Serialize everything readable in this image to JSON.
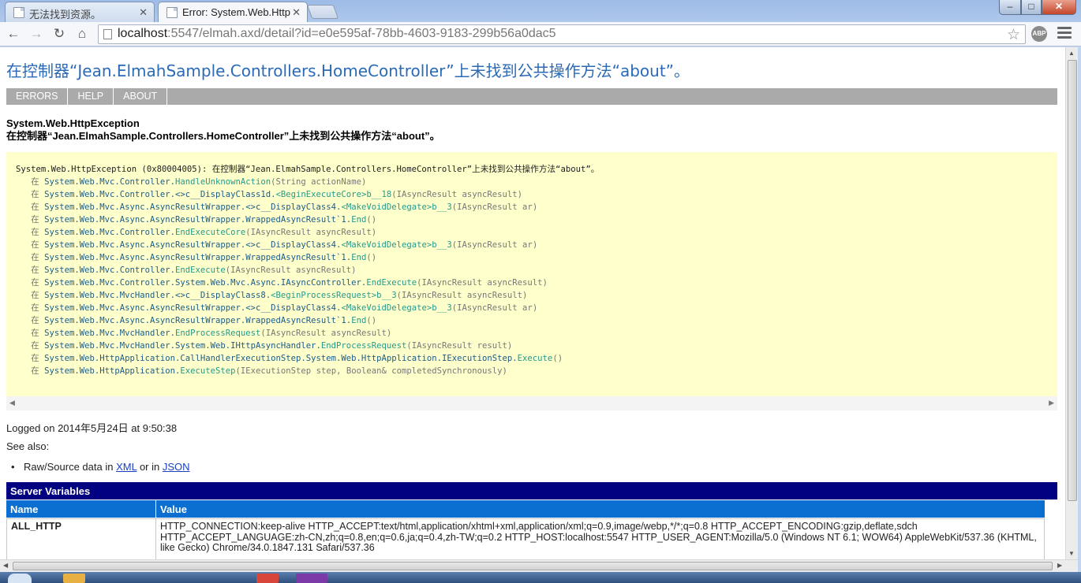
{
  "tabs": [
    {
      "title": "无法找到资源。",
      "active": false
    },
    {
      "title": "Error: System.Web.Http",
      "active": true
    }
  ],
  "window_buttons": {
    "minimize": "–",
    "maximize": "□",
    "close": "✕"
  },
  "toolbar": {
    "back": "←",
    "forward": "→",
    "reload": "↻",
    "home": "⌂",
    "url_host": "localhost",
    "url_path": ":5547/elmah.axd/detail?id=e0e595af-78bb-4603-9183-299b56a0dac5",
    "star": "☆",
    "abp": "ABP"
  },
  "page": {
    "title": "在控制器“Jean.ElmahSample.Controllers.HomeController”上未找到公共操作方法“about”。",
    "nav": [
      "ERRORS",
      "HELP",
      "ABOUT"
    ],
    "error_type": "System.Web.HttpException",
    "error_message": "在控制器“Jean.ElmahSample.Controllers.HomeController”上未找到公共操作方法“about”。",
    "trace_header": "System.Web.HttpException (0x80004005): 在控制器“Jean.ElmahSample.Controllers.HomeController”上未找到公共操作方法“about”。",
    "trace_lines": [
      {
        "pre": "System.Web.Mvc.Controller.",
        "hl": "HandleUnknownAction",
        "post": "(String actionName)"
      },
      {
        "pre": "System.Web.Mvc.Controller.<>c__DisplayClass1d.",
        "hl": "<BeginExecuteCore>b__18",
        "post": "(IAsyncResult asyncResult)"
      },
      {
        "pre": "System.Web.Mvc.Async.AsyncResultWrapper.<>c__DisplayClass4.",
        "hl": "<MakeVoidDelegate>b__3",
        "post": "(IAsyncResult ar)"
      },
      {
        "pre": "System.Web.Mvc.Async.AsyncResultWrapper.WrappedAsyncResult`1.",
        "hl": "End",
        "post": "()"
      },
      {
        "pre": "System.Web.Mvc.Controller.",
        "hl": "EndExecuteCore",
        "post": "(IAsyncResult asyncResult)"
      },
      {
        "pre": "System.Web.Mvc.Async.AsyncResultWrapper.<>c__DisplayClass4.",
        "hl": "<MakeVoidDelegate>b__3",
        "post": "(IAsyncResult ar)"
      },
      {
        "pre": "System.Web.Mvc.Async.AsyncResultWrapper.WrappedAsyncResult`1.",
        "hl": "End",
        "post": "()"
      },
      {
        "pre": "System.Web.Mvc.Controller.",
        "hl": "EndExecute",
        "post": "(IAsyncResult asyncResult)"
      },
      {
        "pre": "System.Web.Mvc.Controller.System.Web.Mvc.Async.IAsyncController.",
        "hl": "EndExecute",
        "post": "(IAsyncResult asyncResult)"
      },
      {
        "pre": "System.Web.Mvc.MvcHandler.<>c__DisplayClass8.",
        "hl": "<BeginProcessRequest>b__3",
        "post": "(IAsyncResult asyncResult)"
      },
      {
        "pre": "System.Web.Mvc.Async.AsyncResultWrapper.<>c__DisplayClass4.",
        "hl": "<MakeVoidDelegate>b__3",
        "post": "(IAsyncResult ar)"
      },
      {
        "pre": "System.Web.Mvc.Async.AsyncResultWrapper.WrappedAsyncResult`1.",
        "hl": "End",
        "post": "()"
      },
      {
        "pre": "System.Web.Mvc.MvcHandler.",
        "hl": "EndProcessRequest",
        "post": "(IAsyncResult asyncResult)"
      },
      {
        "pre": "System.Web.Mvc.MvcHandler.System.Web.IHttpAsyncHandler.",
        "hl": "EndProcessRequest",
        "post": "(IAsyncResult result)"
      },
      {
        "pre": "System.Web.HttpApplication.CallHandlerExecutionStep.System.Web.HttpApplication.IExecutionStep.",
        "hl": "Execute",
        "post": "()"
      },
      {
        "pre": "System.Web.HttpApplication.",
        "hl": "ExecuteStep",
        "post": "(IExecutionStep step, Boolean& completedSynchronously)"
      }
    ],
    "trace_prefix": "在",
    "logged_on": "Logged on 2014年5月24日 at 9:50:38",
    "see_also": "See also:",
    "raw_prefix": "Raw/Source data in",
    "raw_xml": "XML",
    "raw_or": "or in",
    "raw_json": "JSON",
    "server_variables": {
      "title": "Server Variables",
      "col_name": "Name",
      "col_value": "Value",
      "rows": [
        {
          "name": "ALL_HTTP",
          "value": "HTTP_CONNECTION:keep-alive HTTP_ACCEPT:text/html,application/xhtml+xml,application/xml;q=0.9,image/webp,*/*;q=0.8 HTTP_ACCEPT_ENCODING:gzip,deflate,sdch HTTP_ACCEPT_LANGUAGE:zh-CN,zh;q=0.8,en;q=0.6,ja;q=0.4,zh-TW;q=0.2 HTTP_HOST:localhost:5547 HTTP_USER_AGENT:Mozilla/5.0 (Windows NT 6.1; WOW64) AppleWebKit/537.36 (KHTML, like Gecko) Chrome/34.0.1847.131 Safari/537.36"
        }
      ]
    }
  }
}
